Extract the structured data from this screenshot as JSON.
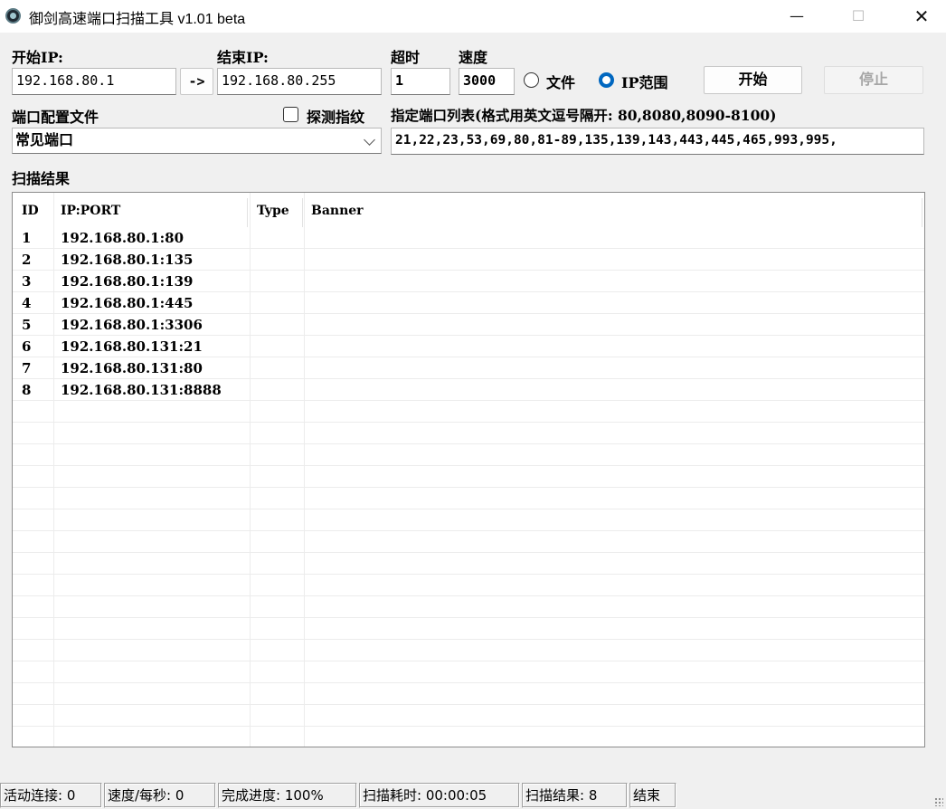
{
  "window": {
    "title": "御剑高速端口扫描工具 v1.01 beta",
    "minimize": "—",
    "maximize": "☐",
    "close": "✕"
  },
  "form": {
    "start_ip_label": "开始IP:",
    "start_ip": "192.168.80.1",
    "arrow_button": "->",
    "end_ip_label": "结束IP:",
    "end_ip": "192.168.80.255",
    "timeout_label": "超时",
    "timeout": "1",
    "speed_label": "速度",
    "speed": "3000",
    "radio_file": "文件",
    "radio_ip_range": "IP范围",
    "radio_selected": "ip_range",
    "start_button": "开始",
    "stop_button": "停止",
    "port_profile_label": "端口配置文件",
    "port_profile": "常见端口",
    "fingerprint_label": "探测指纹",
    "fingerprint_checked": false,
    "port_list_label": "指定端口列表(格式用英文逗号隔开: 80,8080,8090-8100)",
    "port_list": "21,22,23,53,69,80,81-89,135,139,143,443,445,465,993,995,"
  },
  "results": {
    "section_label": "扫描结果",
    "columns": [
      "ID",
      "IP:PORT",
      "Type",
      "Banner"
    ],
    "rows": [
      {
        "id": "1",
        "ip_port": "192.168.80.1:80",
        "type": "",
        "banner": ""
      },
      {
        "id": "2",
        "ip_port": "192.168.80.1:135",
        "type": "",
        "banner": ""
      },
      {
        "id": "3",
        "ip_port": "192.168.80.1:139",
        "type": "",
        "banner": ""
      },
      {
        "id": "4",
        "ip_port": "192.168.80.1:445",
        "type": "",
        "banner": ""
      },
      {
        "id": "5",
        "ip_port": "192.168.80.1:3306",
        "type": "",
        "banner": ""
      },
      {
        "id": "6",
        "ip_port": "192.168.80.131:21",
        "type": "",
        "banner": ""
      },
      {
        "id": "7",
        "ip_port": "192.168.80.131:80",
        "type": "",
        "banner": ""
      },
      {
        "id": "8",
        "ip_port": "192.168.80.131:8888",
        "type": "",
        "banner": ""
      }
    ]
  },
  "status": {
    "active_connections": "活动连接: 0",
    "speed_per_sec": "速度/每秒: 0",
    "progress": "完成进度: 100%",
    "elapsed": "扫描耗时: 00:00:05",
    "result_count": "扫描结果: 8",
    "state": "结束"
  },
  "colors": {
    "window_bg": "#f0f0f0",
    "accent": "#0067c0"
  }
}
